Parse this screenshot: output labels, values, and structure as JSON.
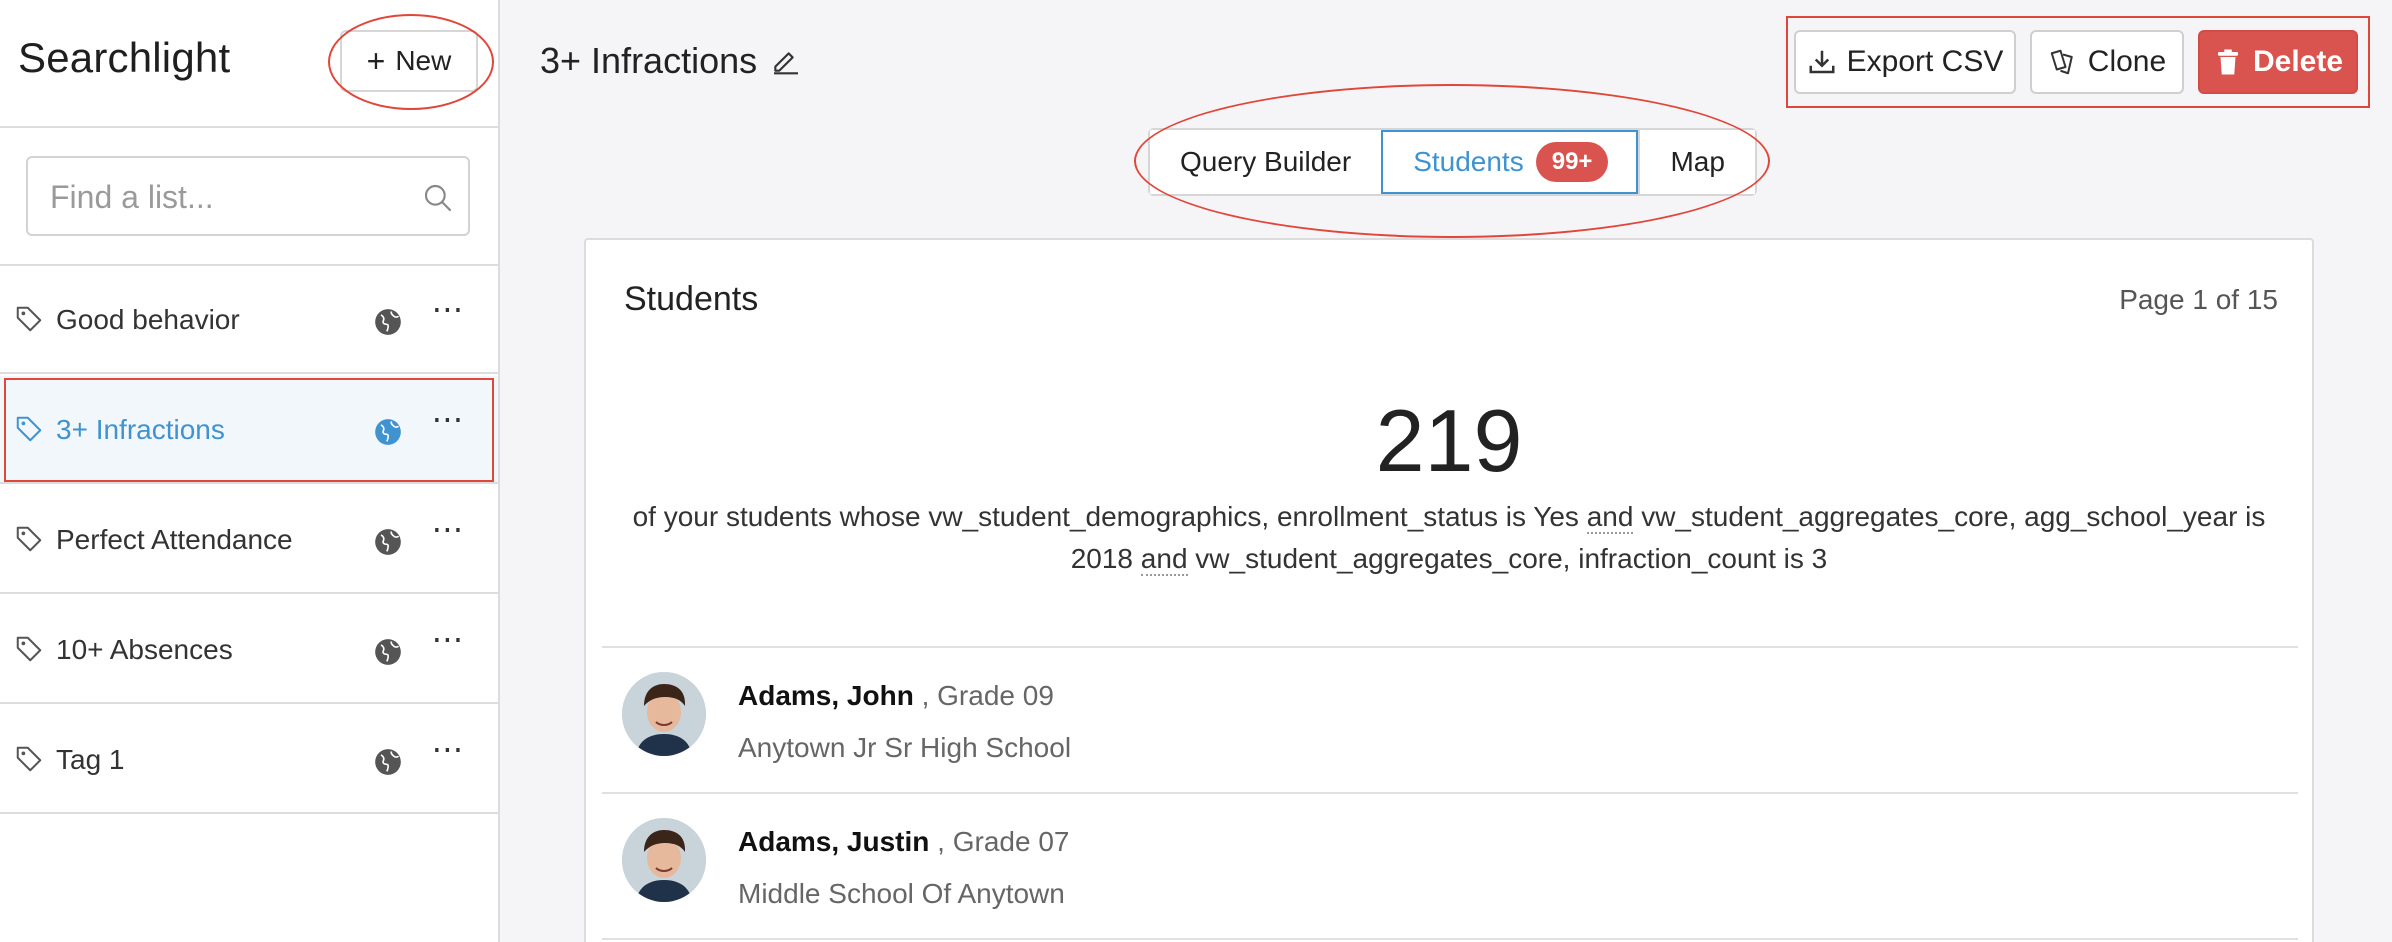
{
  "sidebar": {
    "brand": "Searchlight",
    "new_label": "New",
    "search": {
      "placeholder": "Find a list...",
      "value": ""
    },
    "items": [
      {
        "label": "Good behavior",
        "active": false
      },
      {
        "label": "3+ Infractions",
        "active": true
      },
      {
        "label": "Perfect Attendance",
        "active": false
      },
      {
        "label": "10+ Absences",
        "active": false
      },
      {
        "label": "Tag 1",
        "active": false
      }
    ],
    "more_label": "⋯"
  },
  "header": {
    "title": "3+ Infractions",
    "export_label": "Export CSV",
    "clone_label": "Clone",
    "delete_label": "Delete"
  },
  "tabs": [
    {
      "label": "Query Builder",
      "active": false
    },
    {
      "label": "Students",
      "badge": "99+",
      "active": true
    },
    {
      "label": "Map",
      "active": false
    }
  ],
  "card": {
    "title": "Students",
    "page_info": "Page 1 of 15",
    "count": "219",
    "criteria": {
      "part1": "of your students whose vw_student_demographics, enrollment_status is Yes",
      "conj1": "and",
      "part2": "vw_student_aggregates_core, agg_school_year is 2018",
      "conj2": "and",
      "part3": "vw_student_aggregates_core, infraction_count is 3"
    },
    "students": [
      {
        "name": "Adams, John",
        "grade": ", Grade 09",
        "school": "Anytown Jr Sr High School"
      },
      {
        "name": "Adams, Justin",
        "grade": ", Grade 07",
        "school": "Middle School Of Anytown"
      }
    ]
  },
  "colors": {
    "accent": "#3f93d0",
    "danger": "#d9534f",
    "annotation": "#e0473a",
    "active_row_bg": "#f2f7fb"
  }
}
